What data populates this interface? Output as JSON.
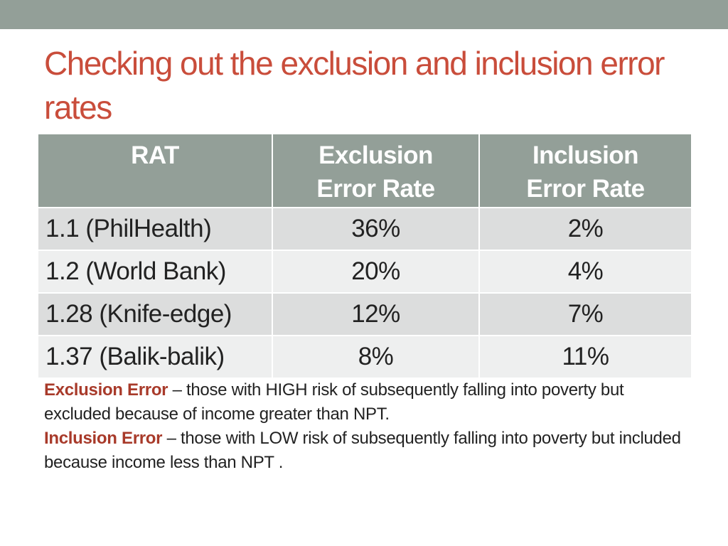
{
  "slide": {
    "title": "Checking out the exclusion and inclusion error rates",
    "accent_color": "#c94d3b",
    "header_band_color": "#939f98"
  },
  "table": {
    "headers": [
      "RAT",
      "Exclusion Error Rate",
      "Inclusion Error Rate"
    ],
    "header_lines": [
      [
        "RAT"
      ],
      [
        "Exclusion",
        "Error Rate"
      ],
      [
        "Inclusion",
        "Error Rate"
      ]
    ],
    "rows": [
      {
        "rat": "1.1 (PhilHealth)",
        "exclusion": "36%",
        "inclusion": "2%"
      },
      {
        "rat": "1.2 (World Bank)",
        "exclusion": "20%",
        "inclusion": "4%"
      },
      {
        "rat": "1.28 (Knife-edge)",
        "exclusion": "12%",
        "inclusion": "7%"
      },
      {
        "rat": "1.37 (Balik-balik)",
        "exclusion": "8%",
        "inclusion": "11%"
      }
    ]
  },
  "notes": {
    "exclusion": {
      "term": "Exclusion Error",
      "text": " – those with  HIGH risk of subsequently falling into poverty but excluded because of income greater than NPT."
    },
    "inclusion": {
      "term": "Inclusion Error",
      "text": " – those with LOW risk of subsequently falling into poverty but included because income less than NPT ."
    }
  }
}
